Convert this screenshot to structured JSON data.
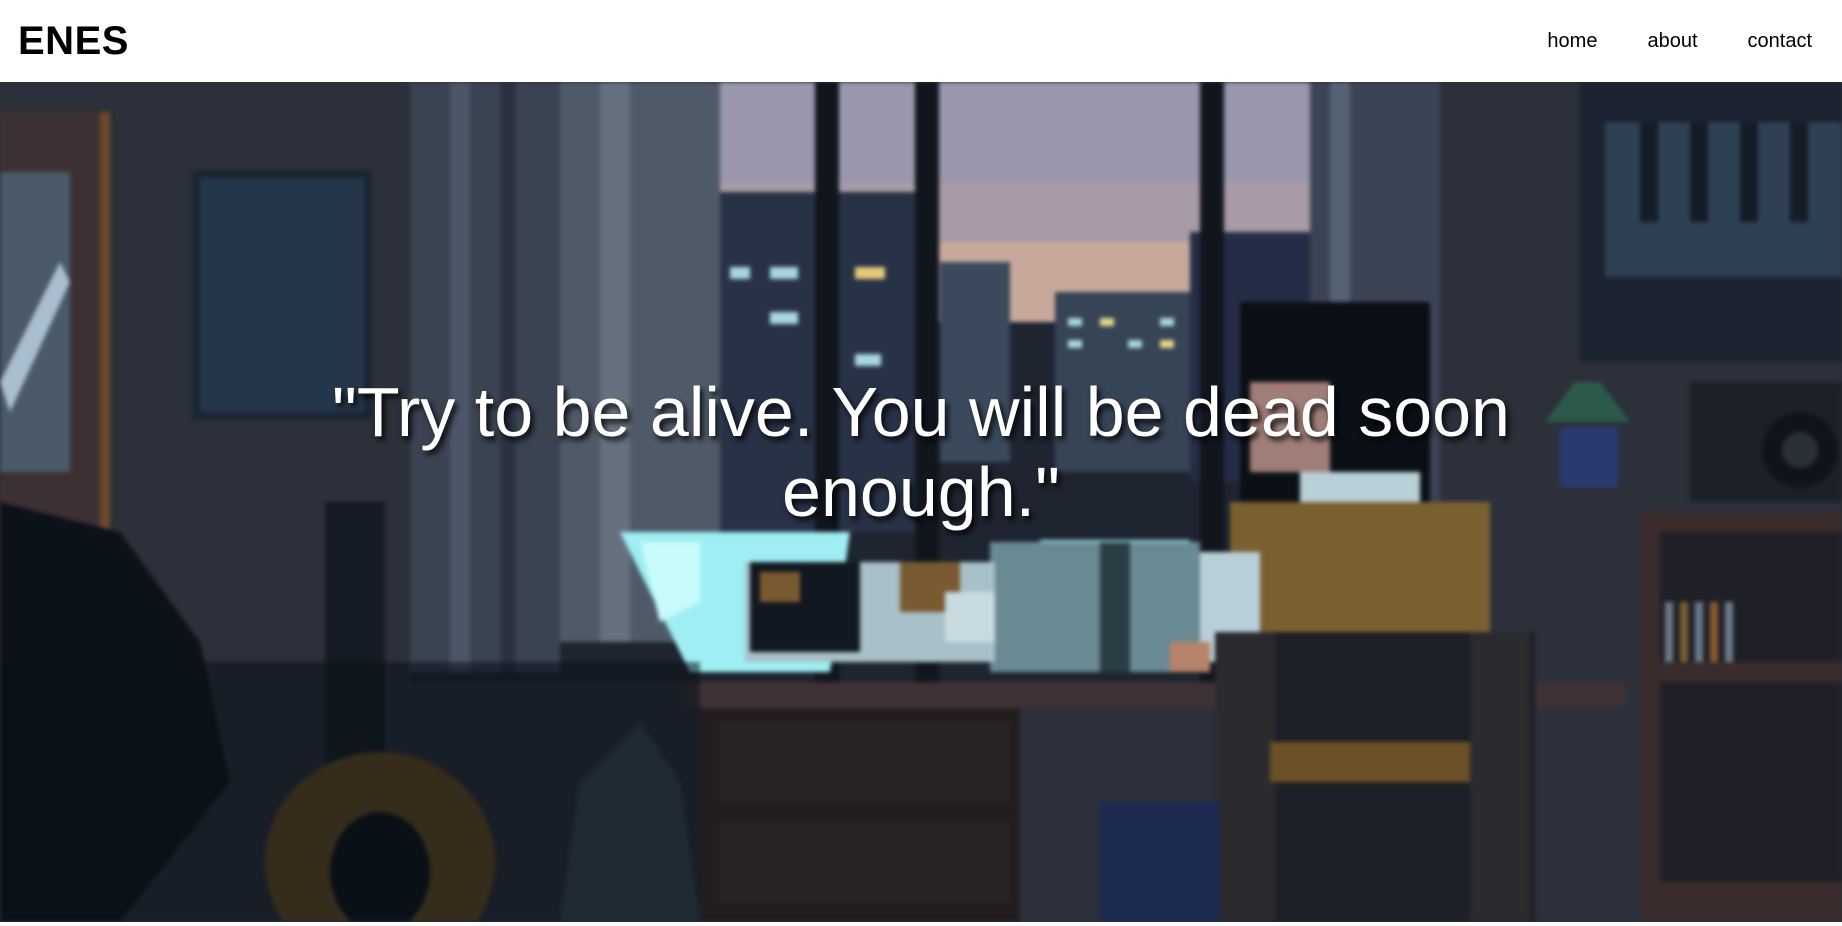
{
  "header": {
    "logo": "ENES",
    "nav": [
      {
        "label": "home"
      },
      {
        "label": "about"
      },
      {
        "label": "contact"
      }
    ]
  },
  "hero": {
    "quote": "\"Try to be alive. You will be dead soon enough.\"",
    "background_image": "pixel-art night room with cat on desk and person looking out window",
    "text_color": "#ffffff"
  },
  "colors": {
    "header_bg": "#ffffff",
    "text": "#000000",
    "hero_wall": "#2b303a",
    "sky": "#8f8aa2",
    "desk": "#3a2e2e",
    "sweater": "#7a6030",
    "screen_glow": "#9aeaf0"
  }
}
